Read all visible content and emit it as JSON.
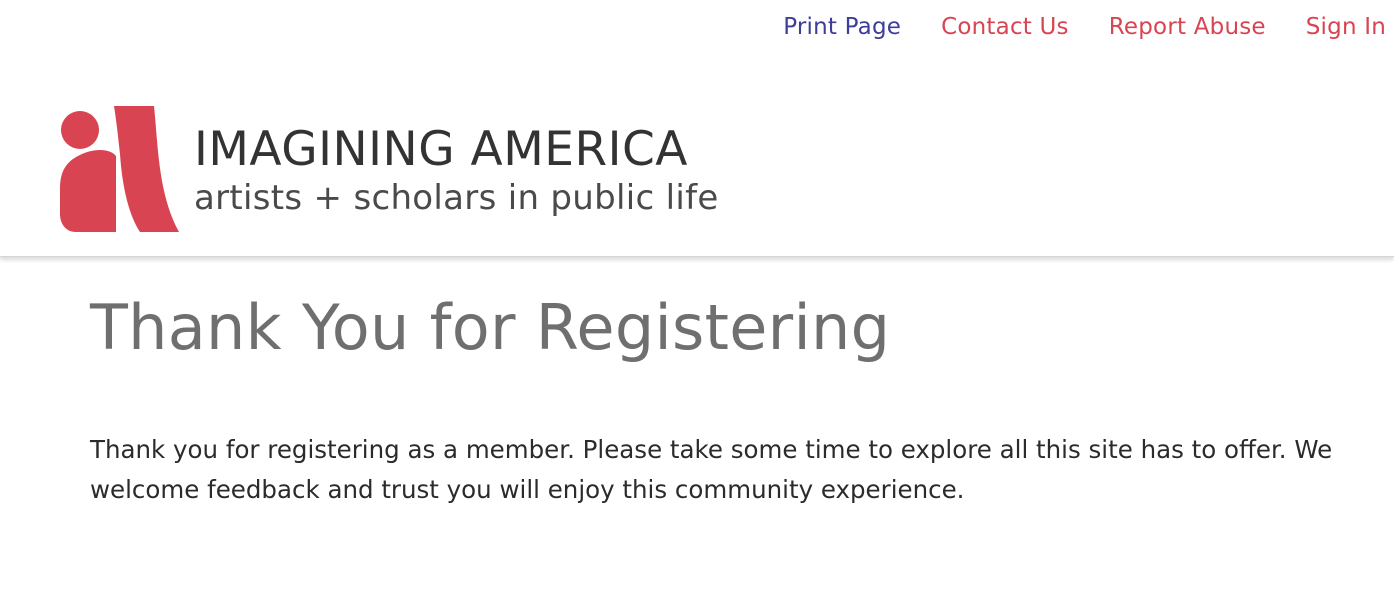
{
  "utility_nav": {
    "print_page": "Print Page",
    "contact_us": "Contact Us",
    "report_abuse": "Report Abuse",
    "sign_in": "Sign In"
  },
  "logo": {
    "title": "IMAGINING AMERICA",
    "tagline": "artists + scholars in public life",
    "brand_color": "#d94452"
  },
  "main": {
    "title": "Thank You for Registering",
    "body": "Thank you for registering as a member. Please take some time to explore all this site has to offer. We welcome feedback and trust you will enjoy this community experience."
  },
  "colors": {
    "link_blue": "#3d3d9a",
    "link_red": "#d94452",
    "title_gray": "#6f6f6f",
    "body_text": "#2b2b2b"
  }
}
